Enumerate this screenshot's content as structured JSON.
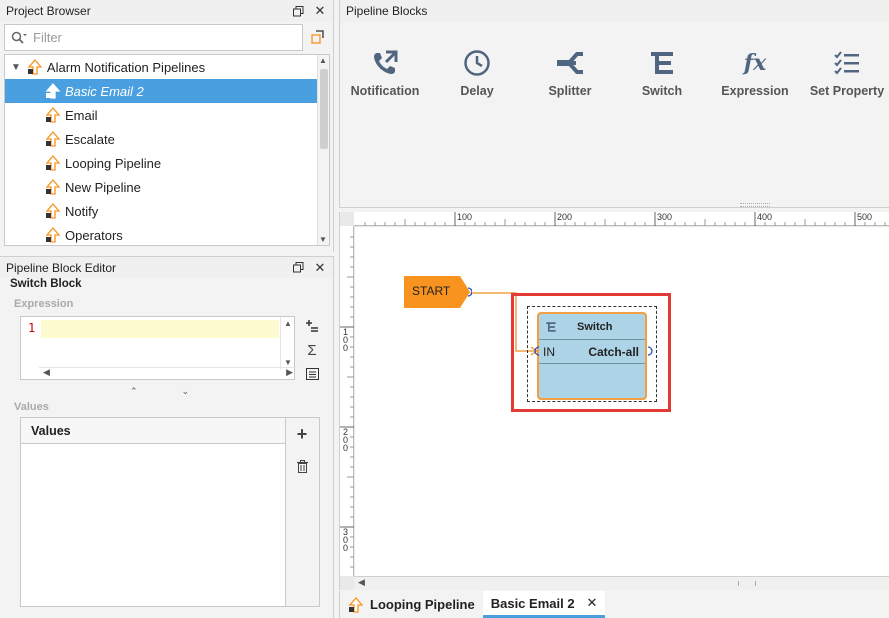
{
  "project_browser": {
    "title": "Project Browser",
    "filter_placeholder": "Filter",
    "root_label": "Alarm Notification Pipelines",
    "items": [
      {
        "label": "Basic Email 2",
        "selected": true
      },
      {
        "label": "Email",
        "selected": false
      },
      {
        "label": "Escalate",
        "selected": false
      },
      {
        "label": "Looping Pipeline",
        "selected": false
      },
      {
        "label": "New Pipeline",
        "selected": false
      },
      {
        "label": "Notify",
        "selected": false
      },
      {
        "label": "Operators",
        "selected": false
      }
    ]
  },
  "block_editor": {
    "title": "Pipeline Block Editor",
    "block_title": "Switch Block",
    "expression_label": "Expression",
    "line_number": "1",
    "values_label": "Values",
    "values_column": "Values"
  },
  "pipeline_blocks": {
    "title": "Pipeline Blocks",
    "items": [
      {
        "label": "Notification",
        "icon": "phone-icon"
      },
      {
        "label": "Delay",
        "icon": "clock-icon"
      },
      {
        "label": "Splitter",
        "icon": "splitter-icon"
      },
      {
        "label": "Switch",
        "icon": "switch-icon"
      },
      {
        "label": "Expression",
        "icon": "fx-icon"
      },
      {
        "label": "Set Property",
        "icon": "checklist-icon"
      }
    ]
  },
  "designer": {
    "ruler_top": [
      "100",
      "200",
      "300",
      "400",
      "500"
    ],
    "ruler_left": [
      "100",
      "200",
      "300"
    ],
    "start_label": "START",
    "switch_node": {
      "title": "Switch",
      "input": "IN",
      "output": "Catch-all"
    }
  },
  "tabs": [
    {
      "label": "Looping Pipeline",
      "active": false
    },
    {
      "label": "Basic Email 2",
      "active": true
    }
  ],
  "colors": {
    "selection": "#4a9fe0",
    "start": "#f7931e",
    "node": "#add3e6",
    "highlight": "#e53935"
  }
}
